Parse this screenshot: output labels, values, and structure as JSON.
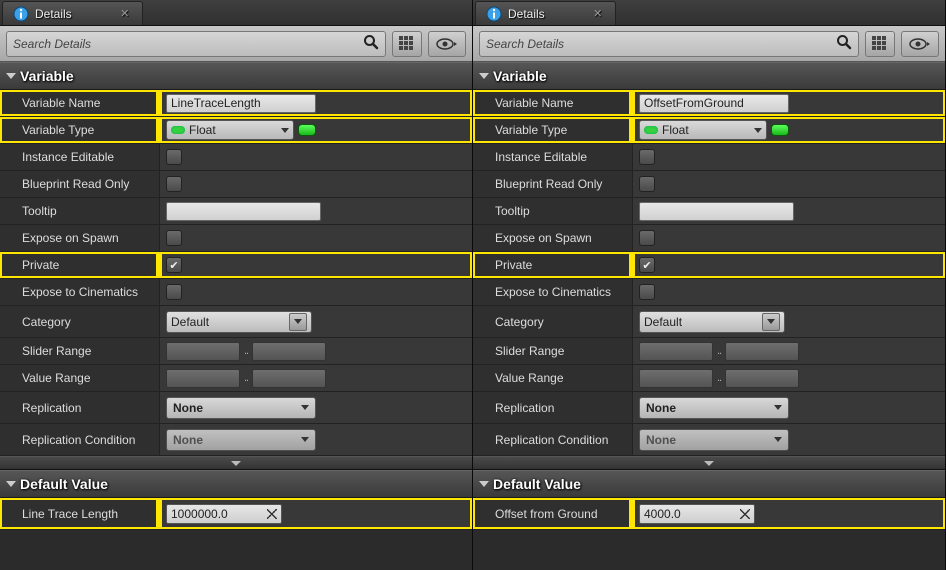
{
  "panels": [
    {
      "tab_title": "Details",
      "search_placeholder": "Search Details",
      "sections": {
        "variable": {
          "title": "Variable",
          "name_label": "Variable Name",
          "name_value": "LineTraceLength",
          "type_label": "Variable Type",
          "type_value": "Float",
          "type_color": "#34d141",
          "instance_editable_label": "Instance Editable",
          "instance_editable": false,
          "blueprint_readonly_label": "Blueprint Read Only",
          "blueprint_readonly": false,
          "tooltip_label": "Tooltip",
          "tooltip_value": "",
          "expose_spawn_label": "Expose on Spawn",
          "expose_spawn": false,
          "private_label": "Private",
          "private": true,
          "expose_cine_label": "Expose to Cinematics",
          "expose_cine": false,
          "category_label": "Category",
          "category_value": "Default",
          "slider_label": "Slider Range",
          "value_range_label": "Value Range",
          "replication_label": "Replication",
          "replication_value": "None",
          "replication_cond_label": "Replication Condition",
          "replication_cond_value": "None"
        },
        "default": {
          "title": "Default Value",
          "field_label": "Line Trace Length",
          "field_value": "1000000.0"
        }
      }
    },
    {
      "tab_title": "Details",
      "search_placeholder": "Search Details",
      "sections": {
        "variable": {
          "title": "Variable",
          "name_label": "Variable Name",
          "name_value": "OffsetFromGround",
          "type_label": "Variable Type",
          "type_value": "Float",
          "type_color": "#34d141",
          "instance_editable_label": "Instance Editable",
          "instance_editable": false,
          "blueprint_readonly_label": "Blueprint Read Only",
          "blueprint_readonly": false,
          "tooltip_label": "Tooltip",
          "tooltip_value": "",
          "expose_spawn_label": "Expose on Spawn",
          "expose_spawn": false,
          "private_label": "Private",
          "private": true,
          "expose_cine_label": "Expose to Cinematics",
          "expose_cine": false,
          "category_label": "Category",
          "category_value": "Default",
          "slider_label": "Slider Range",
          "value_range_label": "Value Range",
          "replication_label": "Replication",
          "replication_value": "None",
          "replication_cond_label": "Replication Condition",
          "replication_cond_value": "None"
        },
        "default": {
          "title": "Default Value",
          "field_label": "Offset from Ground",
          "field_value": "4000.0"
        }
      }
    }
  ]
}
